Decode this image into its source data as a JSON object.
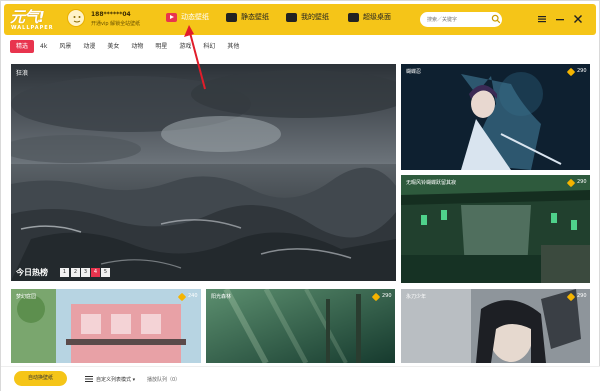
{
  "app": {
    "logo_text": "元气!",
    "logo_sub": "WALLPAPER"
  },
  "user": {
    "id": "188******04",
    "subtitle": "开通vip 解锁全站壁纸"
  },
  "nav": [
    {
      "label": "动态壁纸",
      "icon": "play-icon",
      "active": true
    },
    {
      "label": "静态壁纸",
      "icon": "image-icon",
      "active": false
    },
    {
      "label": "我的壁纸",
      "icon": "folder-icon",
      "active": false
    },
    {
      "label": "超级桌面",
      "icon": "desktop-icon",
      "active": false
    }
  ],
  "search": {
    "placeholder": "搜索／关键字"
  },
  "categories": [
    "精选",
    "4k",
    "风景",
    "动漫",
    "美女",
    "动物",
    "明星",
    "游戏",
    "科幻",
    "其他"
  ],
  "hero": {
    "label": "狂浪",
    "hot_title": "今日热榜",
    "pages": [
      "1",
      "2",
      "3",
      "4",
      "5"
    ],
    "active_page": "4"
  },
  "thumbs": [
    {
      "label": "蝴蝶忍",
      "price": "290"
    },
    {
      "label": "无暇风铃蝴蝶跃留其寂",
      "price": "290"
    },
    {
      "label": "梦幻庭园",
      "price": "240"
    },
    {
      "label": "阳光森林",
      "price": "290"
    },
    {
      "label": "永刀少年",
      "price": "290"
    }
  ],
  "bottom": {
    "auto_label": "自动换壁纸",
    "mode_label": "自定义列表模式 ▾",
    "playlist_label": "播放队列（0）"
  },
  "colors": {
    "header": "#f5c518",
    "accent": "#e8344e"
  }
}
